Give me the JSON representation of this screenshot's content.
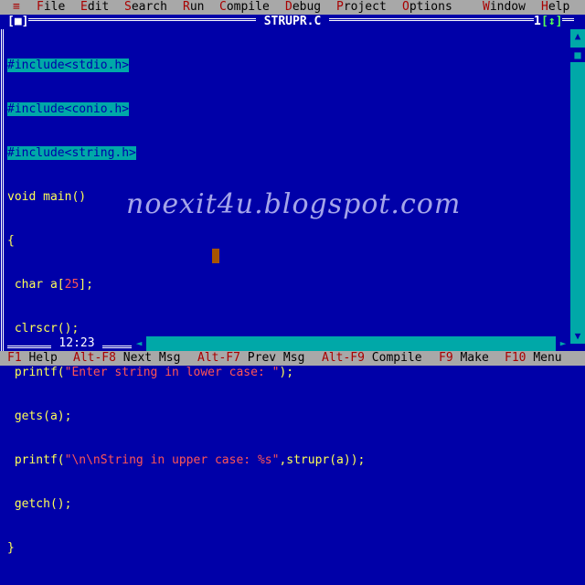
{
  "menu": {
    "system": "≡",
    "items": [
      {
        "hot": "F",
        "rest": "ile"
      },
      {
        "hot": "E",
        "rest": "dit"
      },
      {
        "hot": "S",
        "rest": "earch"
      },
      {
        "hot": "R",
        "rest": "un"
      },
      {
        "hot": "C",
        "rest": "ompile"
      },
      {
        "hot": "D",
        "rest": "ebug"
      },
      {
        "hot": "P",
        "rest": "roject"
      },
      {
        "hot": "O",
        "rest": "ptions"
      },
      {
        "hot": "W",
        "rest": "indow"
      },
      {
        "hot": "H",
        "rest": "elp"
      }
    ]
  },
  "window": {
    "title": "STRUPR.C",
    "close_button": "[■]",
    "number": "1",
    "zoom_button": "[↕]",
    "position": "12:23"
  },
  "code": {
    "includes": [
      "#include<stdio.h>",
      "#include<conio.h>",
      "#include<string.h>"
    ],
    "l4": "void main()",
    "l5": "{",
    "l6a": " char a[",
    "l6n": "25",
    "l6b": "];",
    "l7": " clrscr();",
    "l8a": " printf(",
    "l8s": "\"Enter string in lower case: \"",
    "l8b": ");",
    "l9": " gets(a);",
    "l10a": " printf(",
    "l10s": "\"\\n\\nString in upper case: %s\"",
    "l10b": ",strupr(a));",
    "l11": " getch();",
    "l12": "}"
  },
  "watermark": "noexit4u.blogspot.com",
  "status": [
    {
      "key": "F1",
      "label": "Help"
    },
    {
      "key": "Alt-F8",
      "label": "Next Msg"
    },
    {
      "key": "Alt-F7",
      "label": "Prev Msg"
    },
    {
      "key": "Alt-F9",
      "label": "Compile"
    },
    {
      "key": "F9",
      "label": "Make"
    },
    {
      "key": "F10",
      "label": "Menu"
    }
  ],
  "colors": {
    "background": "#0000a8",
    "menubar": "#a8a8a8",
    "hotkey": "#a80000",
    "code_text": "#ffff55",
    "string_literal": "#ff5555",
    "include_highlight": "#00a8a8",
    "cursor": "#a85400"
  }
}
